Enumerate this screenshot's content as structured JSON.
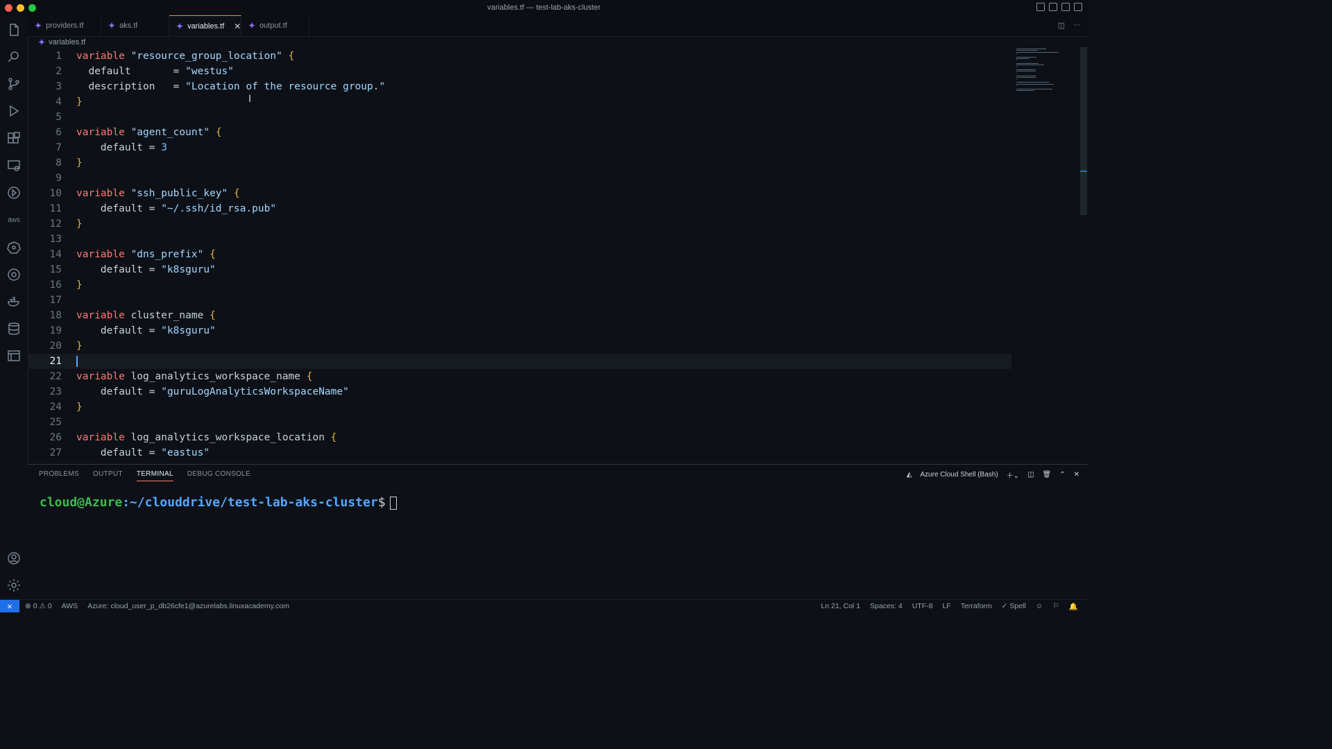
{
  "window": {
    "title": "variables.tf — test-lab-aks-cluster"
  },
  "activity_bar": [
    "files-icon",
    "search-icon",
    "source-control-icon",
    "run-debug-icon",
    "extensions-icon",
    "remote-explorer-icon",
    "play-icon",
    "aws-icon",
    "kubernetes-icon",
    "gitlens-icon",
    "docker-icon",
    "database-icon",
    "panel-icon",
    "account-icon",
    "settings-gear-icon"
  ],
  "activity_labels": {
    "aws": "aws"
  },
  "tabs": [
    {
      "label": "providers.tf",
      "active": false
    },
    {
      "label": "aks.tf",
      "active": false
    },
    {
      "label": "variables.tf",
      "active": true
    },
    {
      "label": "output.tf",
      "active": false
    }
  ],
  "breadcrumb": "variables.tf",
  "editor": {
    "current_line": 21,
    "lines": [
      {
        "n": "1",
        "tokens": [
          [
            "kw",
            "variable"
          ],
          [
            "t",
            " "
          ],
          [
            "str",
            "\"resource_group_location\""
          ],
          [
            "t",
            " "
          ],
          [
            "brace",
            "{"
          ]
        ]
      },
      {
        "n": "2",
        "tokens": [
          [
            "t",
            "  default       = "
          ],
          [
            "str",
            "\"westus\""
          ]
        ]
      },
      {
        "n": "3",
        "tokens": [
          [
            "t",
            "  description   = "
          ],
          [
            "str",
            "\"Location of the resource group.\""
          ]
        ]
      },
      {
        "n": "4",
        "tokens": [
          [
            "brace",
            "}"
          ]
        ]
      },
      {
        "n": "5",
        "tokens": []
      },
      {
        "n": "6",
        "tokens": [
          [
            "kw",
            "variable"
          ],
          [
            "t",
            " "
          ],
          [
            "str",
            "\"agent_count\""
          ],
          [
            "t",
            " "
          ],
          [
            "brace",
            "{"
          ]
        ]
      },
      {
        "n": "7",
        "tokens": [
          [
            "t",
            "    default = "
          ],
          [
            "num",
            "3"
          ]
        ]
      },
      {
        "n": "8",
        "tokens": [
          [
            "brace",
            "}"
          ]
        ]
      },
      {
        "n": "9",
        "tokens": []
      },
      {
        "n": "10",
        "tokens": [
          [
            "kw",
            "variable"
          ],
          [
            "t",
            " "
          ],
          [
            "str",
            "\"ssh_public_key\""
          ],
          [
            "t",
            " "
          ],
          [
            "brace",
            "{"
          ]
        ]
      },
      {
        "n": "11",
        "tokens": [
          [
            "t",
            "    default = "
          ],
          [
            "str",
            "\"~/.ssh/id_rsa.pub\""
          ]
        ]
      },
      {
        "n": "12",
        "tokens": [
          [
            "brace",
            "}"
          ]
        ]
      },
      {
        "n": "13",
        "tokens": []
      },
      {
        "n": "14",
        "tokens": [
          [
            "kw",
            "variable"
          ],
          [
            "t",
            " "
          ],
          [
            "str",
            "\"dns_prefix\""
          ],
          [
            "t",
            " "
          ],
          [
            "brace",
            "{"
          ]
        ]
      },
      {
        "n": "15",
        "tokens": [
          [
            "t",
            "    default = "
          ],
          [
            "str",
            "\"k8sguru\""
          ]
        ]
      },
      {
        "n": "16",
        "tokens": [
          [
            "brace",
            "}"
          ]
        ]
      },
      {
        "n": "17",
        "tokens": []
      },
      {
        "n": "18",
        "tokens": [
          [
            "kw",
            "variable"
          ],
          [
            "t",
            " cluster_name "
          ],
          [
            "brace",
            "{"
          ]
        ]
      },
      {
        "n": "19",
        "tokens": [
          [
            "t",
            "    default = "
          ],
          [
            "str",
            "\"k8sguru\""
          ]
        ]
      },
      {
        "n": "20",
        "tokens": [
          [
            "brace",
            "}"
          ]
        ]
      },
      {
        "n": "21",
        "tokens": []
      },
      {
        "n": "22",
        "tokens": [
          [
            "kw",
            "variable"
          ],
          [
            "t",
            " log_analytics_workspace_name "
          ],
          [
            "brace",
            "{"
          ]
        ]
      },
      {
        "n": "23",
        "tokens": [
          [
            "t",
            "    default = "
          ],
          [
            "str",
            "\"guruLogAnalyticsWorkspaceName\""
          ]
        ]
      },
      {
        "n": "24",
        "tokens": [
          [
            "brace",
            "}"
          ]
        ]
      },
      {
        "n": "25",
        "tokens": []
      },
      {
        "n": "26",
        "tokens": [
          [
            "kw",
            "variable"
          ],
          [
            "t",
            " log_analytics_workspace_location "
          ],
          [
            "brace",
            "{"
          ]
        ]
      },
      {
        "n": "27",
        "tokens": [
          [
            "t",
            "    default = "
          ],
          [
            "str",
            "\"eastus\""
          ]
        ]
      }
    ]
  },
  "panel": {
    "tabs": [
      {
        "label": "PROBLEMS",
        "active": false
      },
      {
        "label": "OUTPUT",
        "active": false
      },
      {
        "label": "TERMINAL",
        "active": true
      },
      {
        "label": "DEBUG CONSOLE",
        "active": false
      }
    ],
    "terminal_name": "Azure Cloud Shell (Bash)",
    "prompt_user": "cloud@Azure",
    "prompt_path": ":~/clouddrive/test-lab-aks-cluster",
    "prompt_symbol": "$"
  },
  "status": {
    "errors": "0",
    "warnings": "0",
    "aws": "AWS",
    "azure": "Azure: cloud_user_p_db26cfe1@azurelabs.linuxacademy.com",
    "position": "Ln 21, Col 1",
    "spaces": "Spaces: 4",
    "encoding": "UTF-8",
    "eol": "LF",
    "language": "Terraform",
    "spell": "Spell"
  },
  "colors": {
    "keyword": "#ff7b72",
    "string": "#a5d6ff",
    "number": "#79c0ff",
    "brace": "#e3b341",
    "accent": "#1f6feb"
  }
}
